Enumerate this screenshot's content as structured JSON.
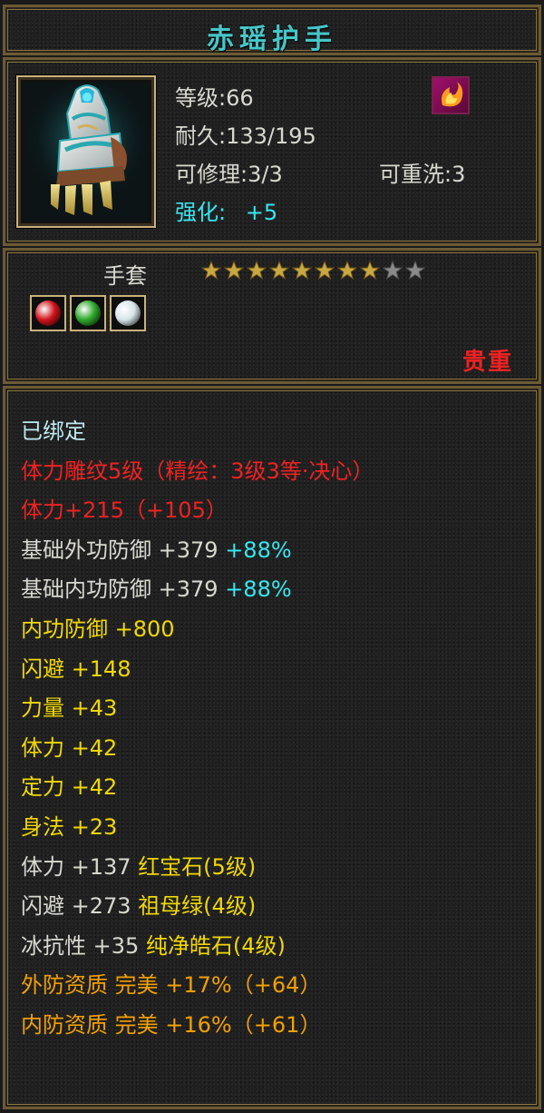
{
  "item": {
    "name": "赤瑶护手",
    "level_label": "等级:66",
    "durability_label": "耐久:133/195",
    "repair_label": "可修理:3/3",
    "rewash_label": "可重洗:3",
    "enhance_label": "强化:",
    "enhance_value": "+5",
    "icon": "gauntlet-icon",
    "badge_icon": "fire-flower-icon",
    "type": "手套",
    "stars_filled": 8,
    "stars_total": 10,
    "gems": [
      {
        "name": "ruby-gem-icon",
        "color": "#d0141c"
      },
      {
        "name": "emerald-gem-icon",
        "color": "#2ea82a"
      },
      {
        "name": "diamond-gem-icon",
        "color": "#d8e4e8"
      }
    ],
    "rarity": "贵重"
  },
  "attributes": [
    {
      "parts": [
        {
          "text": "已绑定",
          "color": "lightcyan"
        }
      ]
    },
    {
      "parts": [
        {
          "text": "体力雕纹5级（精绘：3级3等·决心）",
          "color": "red"
        }
      ]
    },
    {
      "parts": [
        {
          "text": "体力+215（+105）",
          "color": "red"
        }
      ]
    },
    {
      "parts": [
        {
          "text": "基础外功防御 +379 ",
          "color": "white"
        },
        {
          "text": "+88%",
          "color": "cyan"
        }
      ]
    },
    {
      "parts": [
        {
          "text": "基础内功防御 +379 ",
          "color": "white"
        },
        {
          "text": "+88%",
          "color": "cyan"
        }
      ]
    },
    {
      "parts": [
        {
          "text": "内功防御 +800",
          "color": "yellow"
        }
      ]
    },
    {
      "parts": [
        {
          "text": "闪避 +148",
          "color": "yellow"
        }
      ]
    },
    {
      "parts": [
        {
          "text": "力量 +43",
          "color": "yellow"
        }
      ]
    },
    {
      "parts": [
        {
          "text": "体力 +42",
          "color": "yellow"
        }
      ]
    },
    {
      "parts": [
        {
          "text": "定力 +42",
          "color": "yellow"
        }
      ]
    },
    {
      "parts": [
        {
          "text": "身法 +23",
          "color": "yellow"
        }
      ]
    },
    {
      "parts": [
        {
          "text": "体力 +137 ",
          "color": "white"
        },
        {
          "text": "红宝石(5级)",
          "color": "yellow"
        }
      ]
    },
    {
      "parts": [
        {
          "text": "闪避 +273 ",
          "color": "white"
        },
        {
          "text": "祖母绿(4级)",
          "color": "yellow"
        }
      ]
    },
    {
      "parts": [
        {
          "text": "冰抗性 +35 ",
          "color": "white"
        },
        {
          "text": "纯净皓石(4级)",
          "color": "yellow"
        }
      ]
    },
    {
      "parts": [
        {
          "text": "外防资质 完美 +17%（+64）",
          "color": "orange"
        }
      ]
    },
    {
      "parts": [
        {
          "text": "内防资质 完美 +16%（+61）",
          "color": "orange"
        }
      ]
    }
  ],
  "colors": {
    "title": "#46c6c8",
    "border": "#6b5a35",
    "star_filled": "#c8a840",
    "star_empty": "#8a8a8a"
  }
}
